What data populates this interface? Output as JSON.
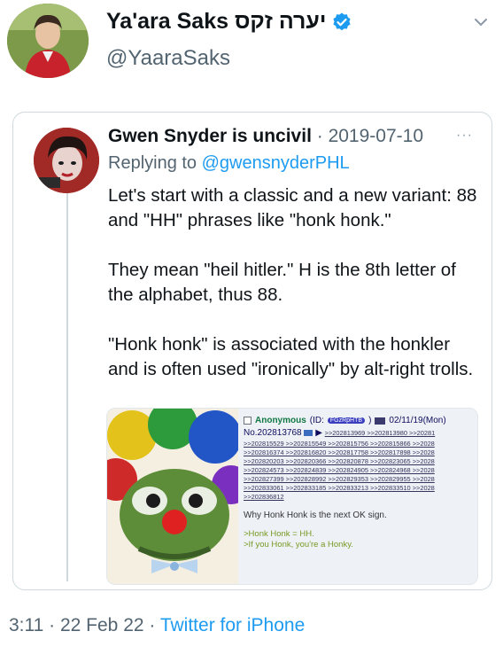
{
  "tweet": {
    "author_name": "Ya'ara Saks יערה זקס",
    "author_handle": "@YaaraSaks",
    "timestamp": "3:11 · 22 Feb 22 · ",
    "source_app": "Twitter for iPhone",
    "icons": [
      "verified-badge-icon",
      "chevron-down-icon"
    ],
    "accent_color": "#1d9bf0"
  },
  "quoted": {
    "author_name": "Gwen Snyder is uncivil",
    "separator": " · ",
    "date": "2019-07-10",
    "more_label": "···",
    "reply_prefix": "Replying to ",
    "reply_handle": "@gwensnyderPHL",
    "paragraphs": [
      "Let's start with a classic and a new variant: 88 and \"HH\" phrases like \"honk honk.\"",
      "They mean \"heil hitler.\" H is the 8th letter of the alphabet, thus 88.",
      "\"Honk honk\" is associated with the honkler and is often used \"ironically\" by alt-right trolls."
    ]
  },
  "embed": {
    "checkbox_label": "",
    "anon_name": "Anonymous",
    "id_prefix": "(ID:",
    "id_value": "FGzRpHTB",
    "id_suffix": ")",
    "date": "02/11/19(Mon)",
    "post_no": "No.202813768",
    "reply_lines": [
      ">>202813969 >>202813980 >>20281",
      ">>202815529 >>202815549 >>202815756 >>202815866 >>2028",
      ">>202816374 >>202816820 >>202817758 >>202817898 >>2028",
      ">>202820203 >>202820366 >>202820878 >>202823065 >>2028",
      ">>202824573 >>202824839 >>202824905 >>202824968 >>2028",
      ">>202827399 >>202828992 >>202829353 >>202829955 >>2028",
      ">>202833061 >>202833185 >>202833213 >>202833510 >>2028",
      ">>202836812"
    ],
    "body": "Why Honk Honk is the next OK sign.",
    "greentext": [
      ">Honk Honk = HH.",
      ">If you Honk, you're a Honky."
    ]
  }
}
